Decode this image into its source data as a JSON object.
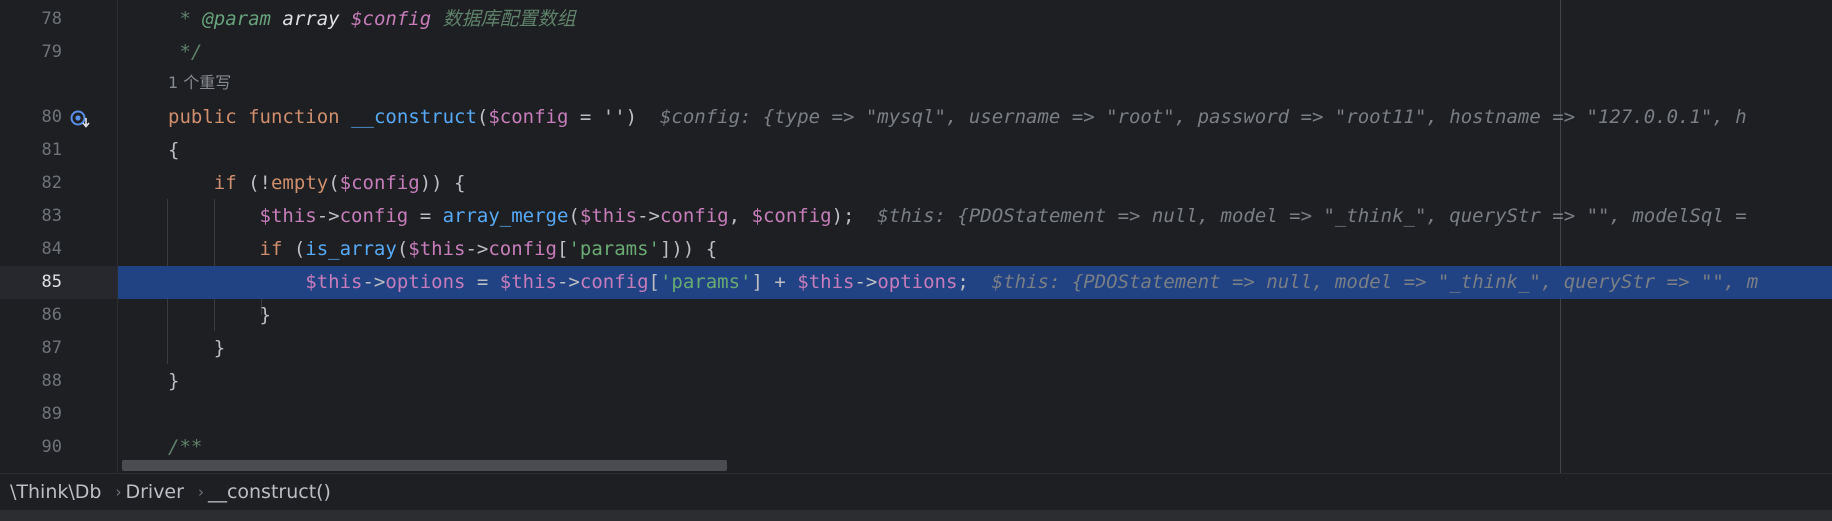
{
  "editor": {
    "lines": [
      {
        "num": "78"
      },
      {
        "num": "79"
      },
      {
        "num": "80"
      },
      {
        "num": "81"
      },
      {
        "num": "82"
      },
      {
        "num": "83"
      },
      {
        "num": "84"
      },
      {
        "num": "85"
      },
      {
        "num": "86"
      },
      {
        "num": "87"
      },
      {
        "num": "88"
      },
      {
        "num": "89"
      },
      {
        "num": "90"
      }
    ],
    "override_hint": "1 个重写",
    "doc_param_tag": "@param",
    "doc_param_type": "array",
    "doc_param_var": "$config",
    "doc_param_desc": "数据库配置数组",
    "doc_end": "*/",
    "doc_start": "/**",
    "sig": {
      "public": "public",
      "function": "function",
      "name": "__construct",
      "open": "(",
      "param": "$config",
      "default": " = '')",
      "hint": "$config: {type => \"mysql\", username => \"root\", password => \"root11\", hostname => \"127.0.0.1\", h"
    },
    "line81": "{",
    "line82": {
      "if": "if",
      "pre": " (!",
      "fn": "empty",
      "open": "(",
      "var": "$config",
      "close": ")) {"
    },
    "line83": {
      "this": "$this",
      "arrow": "->",
      "prop": "config",
      "eq": " = ",
      "fn": "array_merge",
      "open": "(",
      "this2": "$this",
      "arrow2": "->",
      "prop2": "config",
      "comma": ", ",
      "var": "$config",
      "close": ");",
      "hint": "$this: {PDOStatement => null, model => \"_think_\", queryStr => \"\", modelSql ="
    },
    "line84": {
      "if": "if",
      "pre": " (",
      "fn": "is_array",
      "open": "(",
      "this": "$this",
      "arrow": "->",
      "prop": "config",
      "b1": "[",
      "str": "'params'",
      "close": "])) {"
    },
    "line85": {
      "this": "$this",
      "arrow": "->",
      "prop": "options",
      "eq": " = ",
      "this2": "$this",
      "arrow2": "->",
      "prop2": "config",
      "b1": "[",
      "str": "'params'",
      "b2": "] + ",
      "this3": "$this",
      "arrow3": "->",
      "prop3": "options",
      "semi": ";",
      "hint": "$this: {PDOStatement => null, model => \"_think_\", queryStr => \"\", m"
    },
    "line86": "}",
    "line87": "}",
    "line88": "}"
  },
  "breadcrumbs": [
    "\\Think\\Db",
    "Driver",
    "__construct()"
  ],
  "gutter_icon": "override-method-icon",
  "colors": {
    "background": "#1e1f22",
    "selection": "#214283",
    "keyword": "#cf8e6d",
    "function": "#57aaf7",
    "variable": "#c77dbb",
    "string": "#6aab73"
  }
}
